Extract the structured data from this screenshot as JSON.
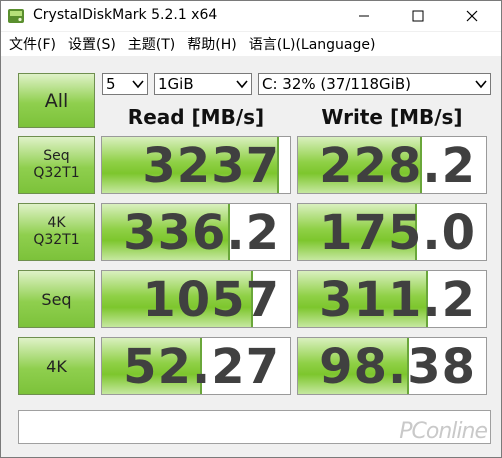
{
  "window": {
    "title": "CrystalDiskMark 5.2.1 x64"
  },
  "menu": {
    "items": [
      "文件(F)",
      "设置(S)",
      "主题(T)",
      "帮助(H)",
      "语言(L)(Language)"
    ]
  },
  "controls": {
    "all_label": "All",
    "count_value": "5",
    "size_value": "1GiB",
    "drive_value": "C: 32% (37/118GiB)"
  },
  "headers": {
    "read": "Read [MB/s]",
    "write": "Write [MB/s]"
  },
  "tests": [
    {
      "line1": "Seq",
      "line2": "Q32T1",
      "read": "3237",
      "write": "228.2",
      "read_fill": 0.93,
      "write_fill": 0.65
    },
    {
      "line1": "4K",
      "line2": "Q32T1",
      "read": "336.2",
      "write": "175.0",
      "read_fill": 0.67,
      "write_fill": 0.62
    },
    {
      "line1": "Seq",
      "line2": "",
      "read": "1057",
      "write": "311.2",
      "read_fill": 0.79,
      "write_fill": 0.68
    },
    {
      "line1": "4K",
      "line2": "",
      "read": "52.27",
      "write": "98.38",
      "read_fill": 0.52,
      "write_fill": 0.58
    }
  ],
  "watermark": "PConline",
  "colors": {
    "accent_green": "#7cc23a",
    "value_text": "#404040"
  }
}
